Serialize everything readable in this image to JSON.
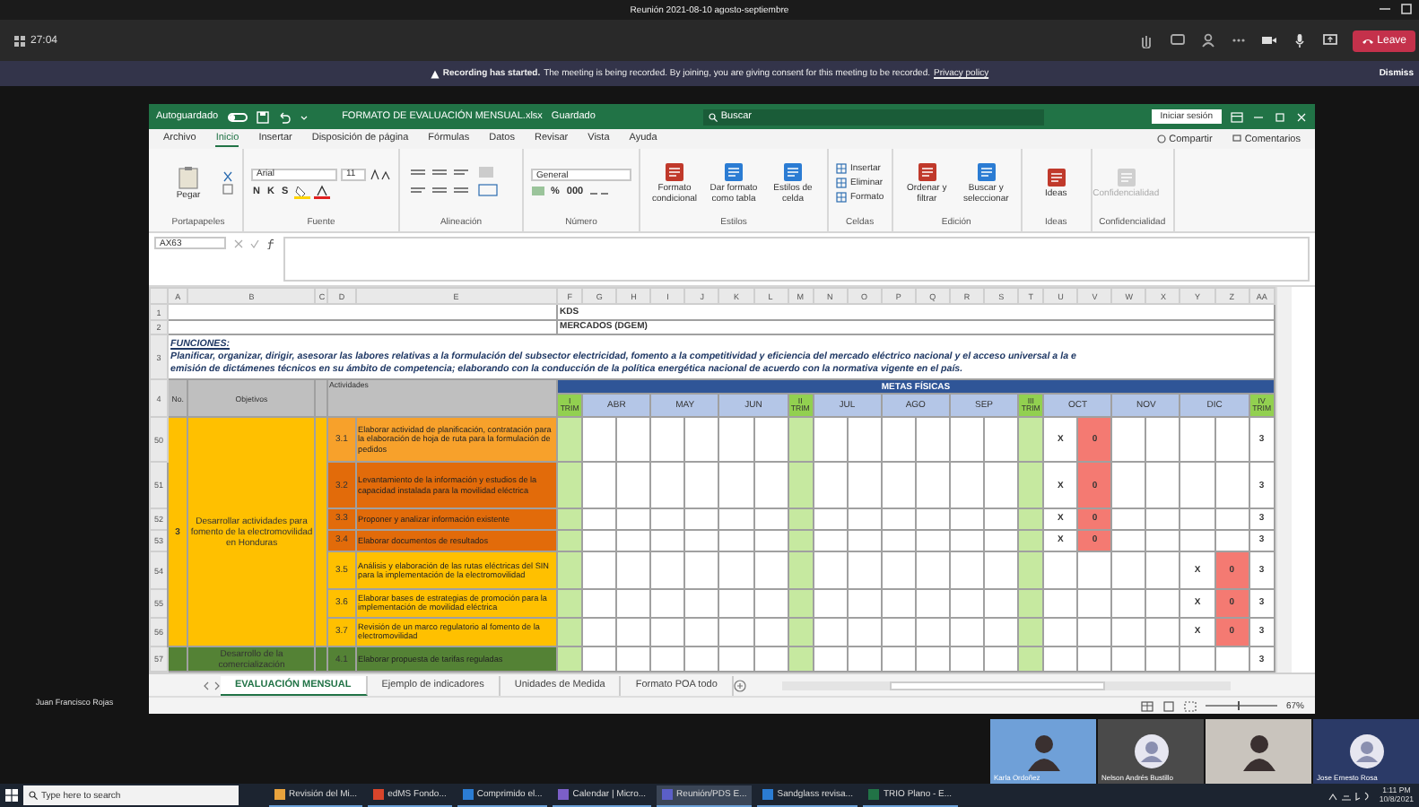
{
  "meeting": {
    "title": "Reunión 2021-08-10 agosto-septiembre",
    "timer": "27:04",
    "leave": "Leave",
    "banner": {
      "bold": "Recording has started.",
      "text": "The meeting is being recorded. By joining, you are giving consent for this meeting to be recorded.",
      "link": "Privacy policy",
      "dismiss": "Dismiss"
    }
  },
  "presenter_name": "Juan Francisco Rojas",
  "excel": {
    "autosave_label": "Autoguardado",
    "autosave_on": false,
    "file_name": "FORMATO DE EVALUACIÓN MENSUAL.xlsx",
    "save_state": "Guardado",
    "search_placeholder": "Buscar",
    "sign_in": "Iniciar sesión",
    "tabs": [
      {
        "label": "Archivo",
        "selected": false
      },
      {
        "label": "Inicio",
        "selected": true
      },
      {
        "label": "Insertar",
        "selected": false
      },
      {
        "label": "Disposición de página",
        "selected": false
      },
      {
        "label": "Fórmulas",
        "selected": false
      },
      {
        "label": "Datos",
        "selected": false
      },
      {
        "label": "Revisar",
        "selected": false
      },
      {
        "label": "Vista",
        "selected": false
      },
      {
        "label": "Ayuda",
        "selected": false
      }
    ],
    "share": "Compartir",
    "comments": "Comentarios",
    "ribbon": [
      {
        "kind": "clipboard",
        "label": "Portapapeles",
        "items": [
          "Pegar"
        ]
      },
      {
        "kind": "font",
        "label": "Fuente",
        "font": "Arial",
        "size": "11",
        "items": [
          "N",
          "K",
          "S"
        ]
      },
      {
        "kind": "alignment",
        "label": "Alineación"
      },
      {
        "kind": "number",
        "label": "Número",
        "format": "General",
        "items": [
          "%",
          "000"
        ]
      },
      {
        "kind": "large",
        "label": "Estilos",
        "items": [
          "Formato condicional",
          "Dar formato como tabla",
          "Estilos de celda"
        ]
      },
      {
        "kind": "list",
        "label": "Celdas",
        "items": [
          "Insertar",
          "Eliminar",
          "Formato"
        ]
      },
      {
        "kind": "large",
        "label": "Edición",
        "items": [
          "Ordenar y filtrar",
          "Buscar y seleccionar"
        ]
      },
      {
        "kind": "large",
        "label": "Ideas",
        "items": [
          "Ideas"
        ]
      },
      {
        "kind": "large",
        "label": "Confidencialidad",
        "items": [
          "Confidencialidad"
        ],
        "disabled": true
      }
    ],
    "name_box": "AX63",
    "sheet": {
      "columns": [
        "A",
        "B",
        "C",
        "D",
        "E",
        "F",
        "G",
        "H",
        "I",
        "J",
        "K",
        "L",
        "M",
        "N",
        "O",
        "P",
        "Q",
        "R",
        "S",
        "T",
        "U",
        "V",
        "W",
        "X",
        "Y",
        "Z",
        "AA"
      ],
      "title_rows": [
        {
          "row": "1",
          "text": "KDS"
        },
        {
          "row": "2",
          "text": "MERCADOS (DGEM)"
        }
      ],
      "functions_row": "3",
      "functions_label": "FUNCIONES:",
      "functions_lines": [
        "Planificar, organizar, dirigir, asesorar las labores relativas a la formulación del subsector electricidad, fomento a la competitividad y eficiencia del mercado eléctrico nacional y el acceso universal a la e",
        "emisión de dictámenes técnicos en su ámbito de competencia; elaborando con la conducción de la política energética nacional de acuerdo con la normativa vigente en el país."
      ],
      "header_row": "4",
      "no_header": "No.",
      "objectives_header": "Objetivos",
      "activities_header": "Actividades",
      "goals_header": "METAS FÍSICAS",
      "periods": [
        {
          "label": "I TRIM",
          "kind": "quarter"
        },
        {
          "label": "ABR",
          "kind": "month"
        },
        {
          "label": "MAY",
          "kind": "month"
        },
        {
          "label": "JUN",
          "kind": "month"
        },
        {
          "label": "II TRIM",
          "kind": "quarter"
        },
        {
          "label": "JUL",
          "kind": "month"
        },
        {
          "label": "AGO",
          "kind": "month"
        },
        {
          "label": "SEP",
          "kind": "month"
        },
        {
          "label": "III TRIM",
          "kind": "quarter"
        },
        {
          "label": "OCT",
          "kind": "month"
        },
        {
          "label": "NOV",
          "kind": "month"
        },
        {
          "label": "DIC",
          "kind": "month"
        },
        {
          "label": "IV TRIM",
          "kind": "quarter"
        }
      ],
      "objectives": [
        {
          "number": "3",
          "text": "Desarrollar actividades para fomento de la electromovilidad en Honduras",
          "color": "#ffc000",
          "activities": [
            {
              "row": "50",
              "id": "3.1",
              "text": "Elaborar actividad de planificación, contratación para la elaboración de hoja de ruta para la formulación de pedidos",
              "color": "#f7a12b",
              "oct": {
                "plan": "X",
                "actual": "0",
                "late": true
              },
              "total": "3"
            },
            {
              "row": "51",
              "id": "3.2",
              "text": "Levantamiento de la información y estudios de la capacidad instalada para la movilidad eléctrica",
              "color": "#e26b0a",
              "oct": {
                "plan": "X",
                "actual": "0",
                "late": true
              },
              "total": "3"
            },
            {
              "row": "52",
              "id": "3.3",
              "text": "Proponer y analizar información existente",
              "color": "#e26b0a",
              "oct": {
                "plan": "X",
                "actual": "0",
                "late": true
              },
              "total": "3"
            },
            {
              "row": "53",
              "id": "3.4",
              "text": "Elaborar documentos de resultados",
              "color": "#e26b0a",
              "oct": {
                "plan": "X",
                "actual": "0",
                "late": true
              },
              "total": "3"
            },
            {
              "row": "54",
              "id": "3.5",
              "text": "Análisis y elaboración de las rutas eléctricas del SIN para la implementación de la electromovilidad",
              "color": "#ffc000",
              "dic": {
                "plan": "X",
                "actual": "0",
                "late": true
              },
              "total": "3"
            },
            {
              "row": "55",
              "id": "3.6",
              "text": "Elaborar bases de estrategias de promoción para la implementación de movilidad eléctrica",
              "color": "#ffc000",
              "dic": {
                "plan": "X",
                "actual": "0",
                "late": true
              },
              "total": "3"
            },
            {
              "row": "56",
              "id": "3.7",
              "text": "Revisión de un marco regulatorio al fomento de la electromovilidad",
              "color": "#ffc000",
              "dic": {
                "plan": "X",
                "actual": "0",
                "late": true
              },
              "total": "3"
            }
          ]
        },
        {
          "text": "Desarrollo de la comercialización",
          "color": "#548235",
          "activities": [
            {
              "row": "57",
              "id": "4.1",
              "text": "Elaborar propuesta de tarifas reguladas",
              "color": "#548235",
              "total": "3"
            }
          ]
        }
      ]
    },
    "sheet_tabs": [
      {
        "label": "EVALUACIÓN MENSUAL",
        "selected": true
      },
      {
        "label": "Ejemplo de indicadores",
        "selected": false
      },
      {
        "label": "Unidades de Medida",
        "selected": false
      },
      {
        "label": "Formato POA todo",
        "selected": false
      }
    ],
    "zoom_slider": {
      "level": 0.45
    },
    "zoom": "67%"
  },
  "participants": [
    {
      "name": "Karla Ordoñez",
      "kind": "video",
      "color": "#6fa0d8"
    },
    {
      "name": "Nelson Andrés Bustillo",
      "kind": "avatar",
      "color": "#4a4a4a"
    },
    {
      "kind": "video",
      "color": "#c9c4bd"
    },
    {
      "name": "Jose Ernesto Rosa",
      "kind": "avatar",
      "color": "#2b3a67"
    }
  ],
  "taskbar": {
    "search_placeholder": "Type here to search",
    "apps": [
      {
        "label": "Revisión del Mi...",
        "color": "#e8a33d",
        "active": false
      },
      {
        "label": "edMS Fondo...",
        "color": "#d9452b",
        "active": false
      },
      {
        "label": "Comprimido el...",
        "color": "#2b7cd3",
        "active": false
      },
      {
        "label": "Calendar | Micro...",
        "color": "#7b5fc7",
        "active": false
      },
      {
        "label": "Reunión/PDS E...",
        "color": "#5b5fc7",
        "active": true
      },
      {
        "label": "Sandglass revisa...",
        "color": "#2b7cd3",
        "active": false
      },
      {
        "label": "TRIO Plano - E...",
        "color": "#217346",
        "active": false
      }
    ],
    "time": "1:11 PM",
    "date": "10/8/2021"
  }
}
